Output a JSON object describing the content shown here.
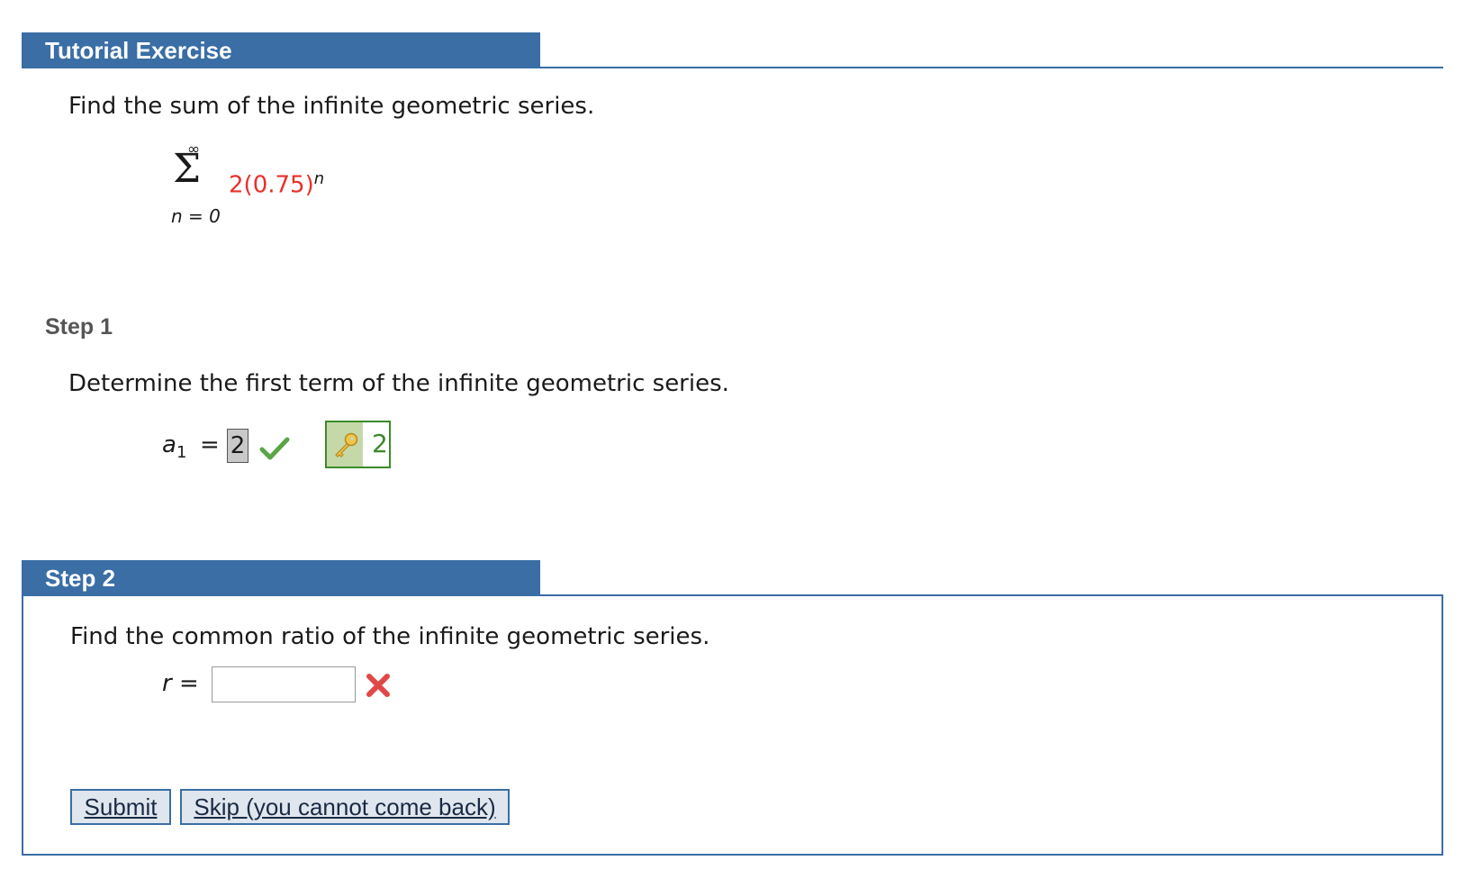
{
  "header": {
    "title": "Tutorial Exercise"
  },
  "problem": {
    "prompt": "Find the sum of the infinite geometric series.",
    "sum_upper": "∞",
    "sum_symbol": "Σ",
    "sum_lower": "n = 0",
    "term_coef": "2",
    "term_base": "(0.75)",
    "term_exp": "n"
  },
  "step1": {
    "label": "Step 1",
    "prompt": "Determine the first term of the infinite geometric series.",
    "var_name": "a",
    "var_sub": "1",
    "equals": "=",
    "answer_value": "2",
    "key_value": "2"
  },
  "step2": {
    "label": "Step 2",
    "prompt": "Find the common ratio of the infinite geometric series.",
    "var_label": "r =",
    "input_value": ""
  },
  "buttons": {
    "submit": "Submit",
    "skip": "Skip (you cannot come back)"
  },
  "colors": {
    "header_bg": "#3a6ea5",
    "highlight_red": "#e8302a",
    "correct_green": "#3b8a2a"
  }
}
